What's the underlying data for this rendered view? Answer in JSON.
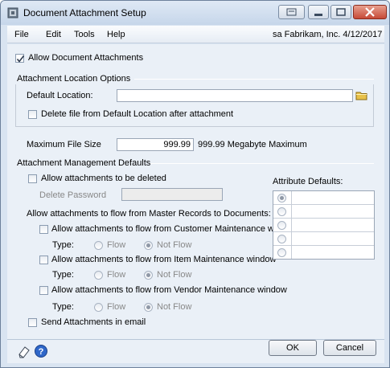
{
  "window": {
    "title": "Document Attachment Setup"
  },
  "menu": {
    "file": "File",
    "edit": "Edit",
    "tools": "Tools",
    "help": "Help",
    "company_info": "sa  Fabrikam, Inc. 4/12/2017"
  },
  "allow_document_attachments": {
    "label": "Allow Document Attachments",
    "checked": true
  },
  "location_options": {
    "heading": "Attachment Location Options",
    "default_location_label": "Default Location:",
    "default_location_value": "",
    "delete_after_label": "Delete file from Default Location after attachment",
    "delete_after_checked": false
  },
  "max_file_size": {
    "label": "Maximum File Size",
    "value": "999.99",
    "suffix": "999.99 Megabyte Maximum"
  },
  "management": {
    "heading": "Attachment Management Defaults",
    "allow_delete_label": "Allow attachments to be deleted",
    "allow_delete_checked": false,
    "delete_password_label": "Delete Password",
    "delete_password_value": "",
    "flow_heading": "Allow attachments to flow from Master Records to Documents:",
    "type_label": "Type:",
    "flow_label": "Flow",
    "not_flow_label": "Not Flow",
    "flows": [
      {
        "label": "Allow attachments to flow from Customer Maintenance window",
        "checked": false,
        "selected": "Not Flow"
      },
      {
        "label": "Allow attachments to flow from Item Maintenance window",
        "checked": false,
        "selected": "Not Flow"
      },
      {
        "label": "Allow attachments to flow from Vendor Maintenance window",
        "checked": false,
        "selected": "Not Flow"
      }
    ],
    "send_email_label": "Send Attachments in email",
    "send_email_checked": false
  },
  "attribute_defaults": {
    "label": "Attribute Defaults:",
    "rows": [
      "",
      "",
      "",
      "",
      ""
    ],
    "selected_index": 0
  },
  "buttons": {
    "ok": "OK",
    "cancel": "Cancel"
  },
  "colors": {
    "window_bg": "#d9e4f1",
    "client_bg": "#eaf0f7",
    "folder_icon": "#e8c14a"
  }
}
